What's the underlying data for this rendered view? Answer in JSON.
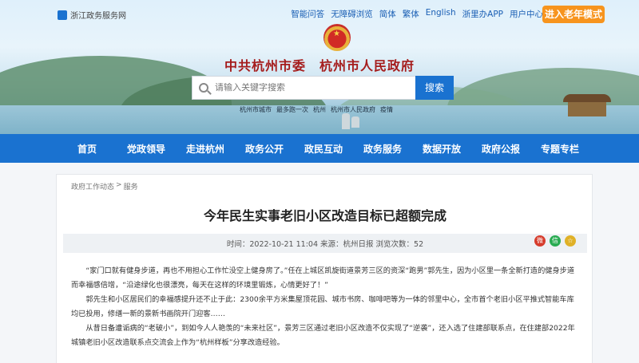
{
  "header": {
    "portal_name": "浙江政务服务网",
    "top_links": [
      "智能问答",
      "无障碍浏览",
      "简体",
      "繁体",
      "English",
      "浙里办APP",
      "用户中心"
    ],
    "elder_mode": "进入老年模式",
    "site_title": "中共杭州市委　杭州市人民政府",
    "search_placeholder": "请输入关键字搜索",
    "search_button": "搜索",
    "hot_words": [
      "杭州市城市",
      "最多跑一次",
      "杭州",
      "杭州市人民政府",
      "疫情"
    ]
  },
  "nav": {
    "items": [
      "首页",
      "党政领导",
      "走进杭州",
      "政务公开",
      "政民互动",
      "政务服务",
      "数据开放",
      "政府公报",
      "专题专栏"
    ]
  },
  "article": {
    "breadcrumb": [
      "政府工作动态",
      ">",
      "服务"
    ],
    "title": "今年民生实事老旧小区改造目标已超额完成",
    "meta": "时间：2022-10-21 11:04 来源：杭州日报 浏览次数：52",
    "share_icons": [
      "weibo-icon",
      "wechat-icon",
      "favorite-icon"
    ],
    "paragraphs": [
      "“家门口就有健身步道，再也不用担心工作忙没空上健身房了。”任在上城区凯旋街道景芳三区的资深“跑男”郭先生，因为小区里一条全新打造的健身步道而幸福感倍增，“沿途绿化也很漂亮，每天在这样的环境里锻炼，心情更好了！”",
      "郭先生和小区居民们的幸福感提升还不止于此：2300余平方米集屋顶花园、城市书房、咖啡吧等为一体的邻里中心，全市首个老旧小区平推式智能车库均已投用，修缮一新的景新书画院开门迎客……",
      "从昔日备遭诟病的“老破小”，到如今人人艳羡的“未来社区”，景芳三区通过老旧小区改造不仅实现了“逆袭”，还入选了住建部联系点，在住建部2022年城镇老旧小区改造联系点交流会上作为“杭州样板”分享改造经验。"
    ]
  },
  "colors": {
    "brand_blue": "#1a72d0",
    "elder_orange": "#f7941d",
    "title_red": "#a51c1c"
  }
}
